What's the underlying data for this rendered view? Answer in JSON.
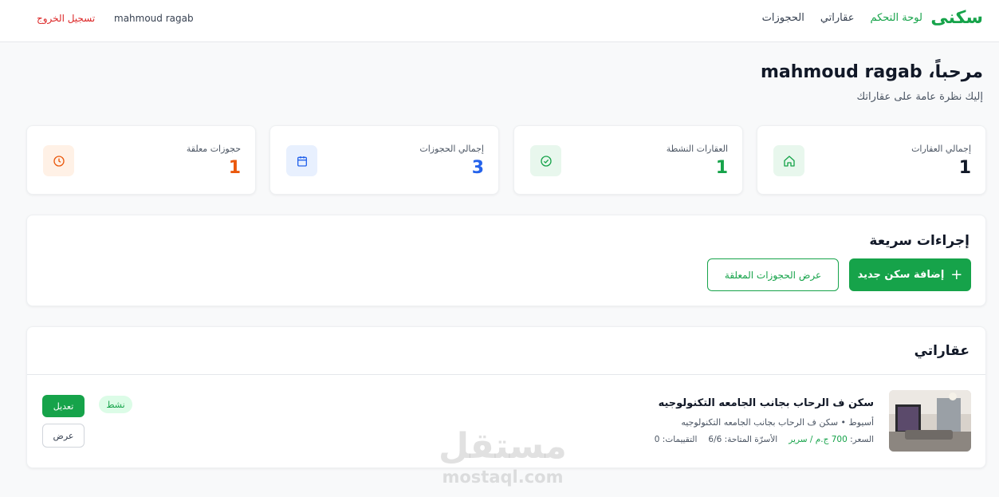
{
  "nav": {
    "brand": "سكنى",
    "items": [
      {
        "label": "لوحة التحكم",
        "active": true
      },
      {
        "label": "عقاراتي",
        "active": false
      },
      {
        "label": "الحجوزات",
        "active": false
      }
    ],
    "user_name": "mahmoud ragab",
    "logout": "تسجيل الخروج"
  },
  "welcome": {
    "title": "مرحباً، mahmoud ragab",
    "subtitle": "إليك نظرة عامة على عقاراتك"
  },
  "stats": [
    {
      "label": "إجمالي العقارات",
      "value": "1",
      "icon": "home-icon",
      "color": "#111827",
      "icon_color": "#16a34a",
      "icon_bg": "#e8f7ed"
    },
    {
      "label": "العقارات النشطة",
      "value": "1",
      "icon": "check-circle-icon",
      "color": "#16a34a",
      "icon_color": "#16a34a",
      "icon_bg": "#e8f7ed"
    },
    {
      "label": "إجمالي الحجوزات",
      "value": "3",
      "icon": "calendar-icon",
      "color": "#2563eb",
      "icon_color": "#2563eb",
      "icon_bg": "#e8f0fe"
    },
    {
      "label": "حجوزات معلقة",
      "value": "1",
      "icon": "clock-icon",
      "color": "#ea580c",
      "icon_color": "#ea580c",
      "icon_bg": "#fff1e6"
    }
  ],
  "quick_actions": {
    "title": "إجراءات سريعة",
    "add_label": "إضافة سكن جديد",
    "pending_label": "عرض الحجوزات المعلقة"
  },
  "properties": {
    "title": "عقاراتي",
    "items": [
      {
        "name": "سكن ف الرحاب بجانب الجامعه التكنولوجيه",
        "location": "أسيوط • سكن ف الرحاب بجانب الجامعه التكنولوجيه",
        "price_label": "السعر:",
        "price_value": "700 ج.م / سرير",
        "beds_label": "الأسرّة المتاحة:",
        "beds_value": "6/6",
        "reviews_label": "التقييمات:",
        "reviews_value": "0",
        "status": "نشط",
        "edit_label": "تعديل",
        "view_label": "عرض"
      }
    ]
  },
  "watermark": {
    "ar": "مستقل",
    "en": "mostaql.com"
  },
  "colors": {
    "accent": "#16a34a",
    "danger": "#dc2626",
    "blue": "#2563eb",
    "orange": "#ea580c"
  }
}
